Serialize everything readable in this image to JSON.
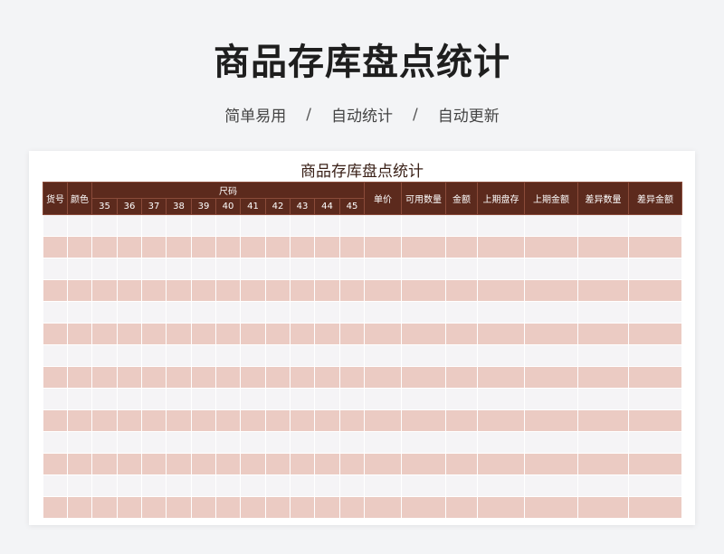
{
  "page": {
    "title": "商品存库盘点统计",
    "features": [
      "简单易用",
      "自动统计",
      "自动更新"
    ],
    "separator": "/"
  },
  "sheet": {
    "title": "商品存库盘点统计",
    "headers": {
      "item_no": "货号",
      "color": "颜色",
      "size_group": "尺码",
      "sizes": [
        "35",
        "36",
        "37",
        "38",
        "39",
        "40",
        "41",
        "42",
        "43",
        "44",
        "45"
      ],
      "unit_price": "单价",
      "available_qty": "可用数量",
      "amount": "金额",
      "last_stock": "上期盘存",
      "last_amount": "上期金额",
      "diff_qty": "差异数量",
      "diff_amount": "差异金额"
    },
    "row_count": 14
  },
  "colors": {
    "header_bg": "#5c2a1d",
    "row_odd": "#f5f4f6",
    "row_even": "#ebcbc3"
  }
}
